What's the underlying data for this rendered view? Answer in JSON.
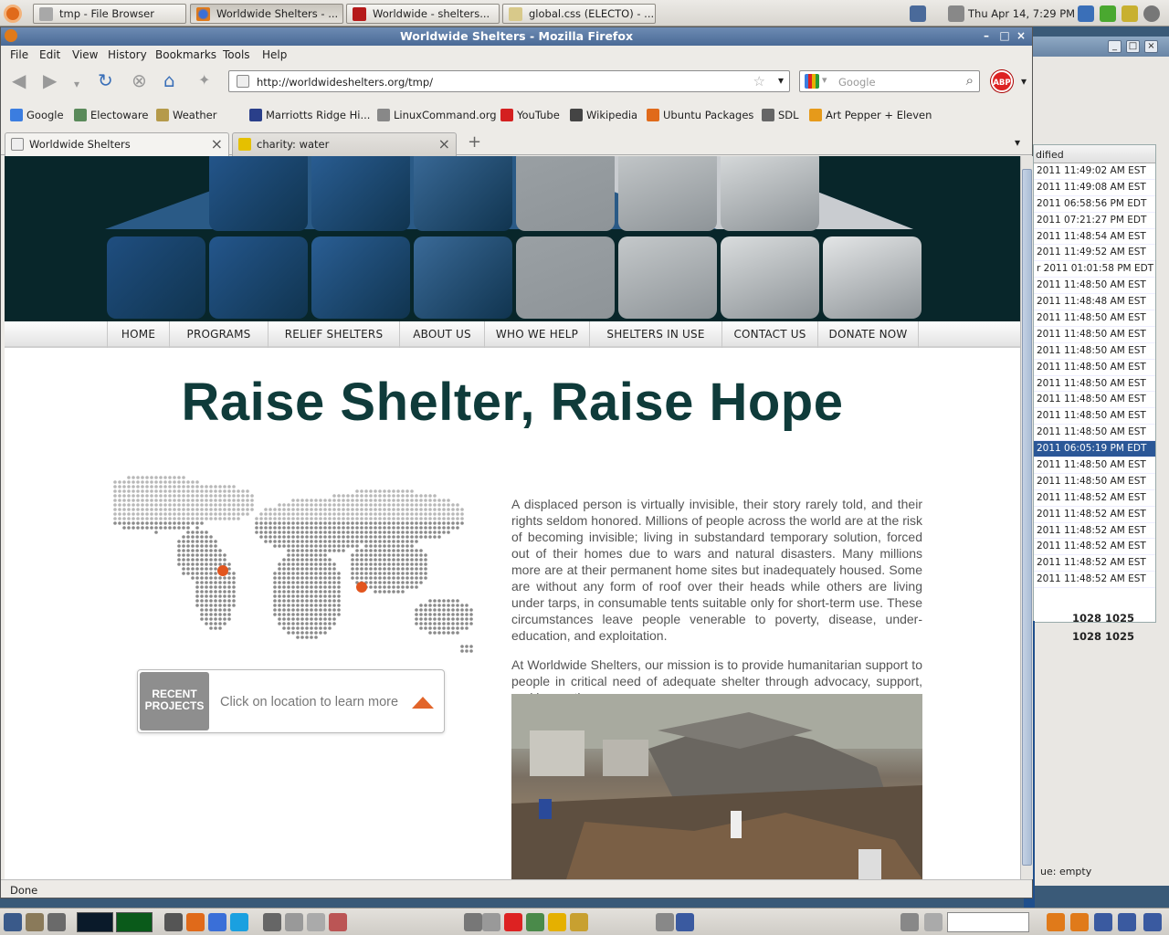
{
  "top_panel": {
    "tasks": [
      {
        "label": "tmp - File Browser",
        "active": false
      },
      {
        "label": "Worldwide Shelters - ...",
        "active": true
      },
      {
        "label": "Worldwide - shelters...",
        "active": false
      },
      {
        "label": "global.css (ELECTO) - ...",
        "active": false
      }
    ],
    "clock": "Thu Apr 14,  7:29 PM"
  },
  "bg_window": {
    "column_header": "dified",
    "rows": [
      "2011 11:49:02 AM EST",
      "2011 11:49:08 AM EST",
      "2011 06:58:56 PM EDT",
      "2011 07:21:27 PM EDT",
      "2011 11:48:54 AM EST",
      "2011 11:49:52 AM EST",
      "r 2011 01:01:58 PM EDT",
      "2011 11:48:50 AM EST",
      "2011 11:48:48 AM EST",
      "2011 11:48:50 AM EST",
      "2011 11:48:50 AM EST",
      "2011 11:48:50 AM EST",
      "2011 11:48:50 AM EST",
      "2011 11:48:50 AM EST",
      "2011 11:48:50 AM EST",
      "2011 11:48:50 AM EST",
      "2011 11:48:50 AM EST",
      "2011 06:05:19 PM EDT",
      "2011 11:48:50 AM EST",
      "2011 11:48:50 AM EST",
      "2011 11:48:52 AM EST",
      "2011 11:48:52 AM EST",
      "2011 11:48:52 AM EST",
      "2011 11:48:52 AM EST",
      "2011 11:48:52 AM EST",
      "2011 11:48:52 AM EST"
    ],
    "selected_row": 17,
    "nums": [
      "1028 1025",
      "1028 1025"
    ],
    "status": "ue: empty"
  },
  "firefox": {
    "title": "Worldwide Shelters - Mozilla Firefox",
    "menu": [
      "File",
      "Edit",
      "View",
      "History",
      "Bookmarks",
      "Tools",
      "Help"
    ],
    "url": "http://worldwideshelters.org/tmp/",
    "search_placeholder": "Google",
    "abp": "ABP",
    "bookmarks": [
      {
        "label": "Google",
        "color": "#3b7de0"
      },
      {
        "label": "Electoware",
        "color": "#5a8a5a"
      },
      {
        "label": "Weather",
        "color": "#b59a4a"
      },
      {
        "label": "Marriotts Ridge Hi...",
        "color": "#2a3f8a"
      },
      {
        "label": "LinuxCommand.org",
        "color": "#888888"
      },
      {
        "label": "YouTube",
        "color": "#d42020"
      },
      {
        "label": "Wikipedia",
        "color": "#444444"
      },
      {
        "label": "Ubuntu Packages",
        "color": "#e06a1a"
      },
      {
        "label": "SDL",
        "color": "#666666"
      },
      {
        "label": "Art Pepper + Eleven",
        "color": "#e69a1a"
      }
    ],
    "tabs": [
      {
        "label": "Worldwide Shelters",
        "active": true
      },
      {
        "label": "charity: water",
        "active": false
      }
    ],
    "status": "Done"
  },
  "site": {
    "nav": [
      "HOME",
      "PROGRAMS",
      "RELIEF SHELTERS",
      "ABOUT US",
      "WHO WE HELP",
      "SHELTERS IN USE",
      "CONTACT US",
      "DONATE NOW"
    ],
    "headline": "Raise Shelter, Raise Hope",
    "recent_projects": "RECENT PROJECTS",
    "click_text": "Click on location to learn more",
    "para1": "A displaced person is virtually invisible, their story rarely told, and their rights seldom honored. Millions of people across the world are at the risk of becoming invisible; living in substandard temporary solution, forced out of their homes due to wars and natural disasters. Many millions more are at their permanent home sites but inadequately housed. Some are without any form of roof over their heads while others are living under tarps, in consumable tents suitable only for short-term use. These circumstances leave people venerable to poverty, disease, under-education, and exploitation.",
    "para2": "At Worldwide Shelters, our mission is to provide humanitarian support to people in critical need of adequate shelter through advocacy, support, and innovation."
  }
}
